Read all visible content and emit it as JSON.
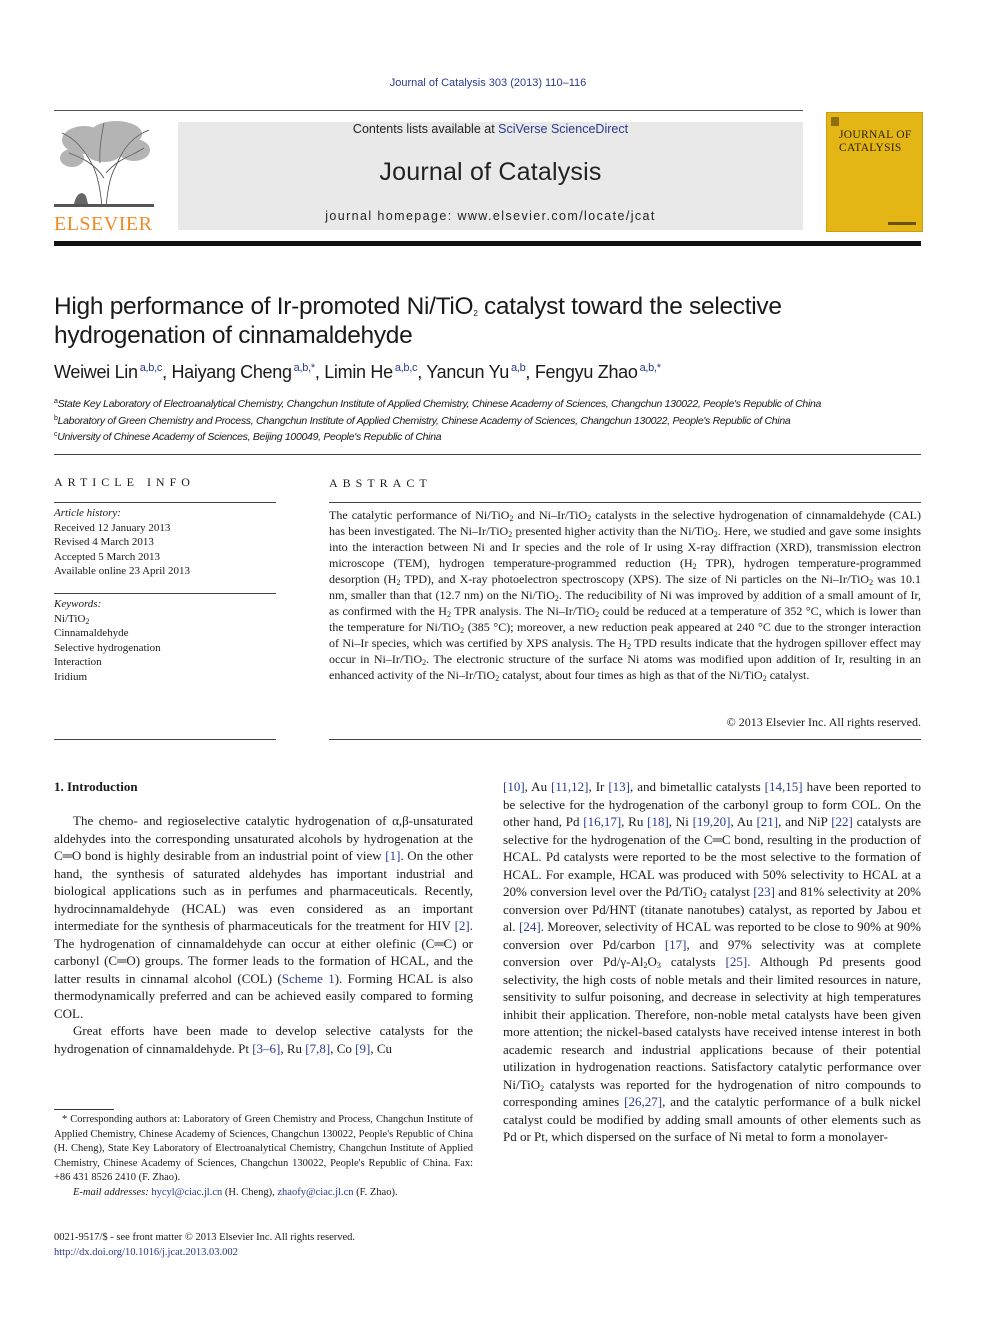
{
  "header": {
    "journal_ref": "Journal of Catalysis 303 (2013) 110–116",
    "contents_prefix": "Contents lists available at ",
    "contents_link": "SciVerse ScienceDirect",
    "journal_name": "Journal of Catalysis",
    "homepage": "journal homepage: www.elsevier.com/locate/jcat",
    "publisher_logo_text": "ELSEVIER",
    "cover_title_line1": "JOURNAL OF",
    "cover_title_line2": "CATALYSIS",
    "colors": {
      "publisher_orange": "#f08a24",
      "cover_yellow": "#e3b616",
      "banner_gray": "#e9e9e9",
      "link_blue": "#2a3a8c"
    }
  },
  "article": {
    "title_part1": "High performance of Ir-promoted Ni/TiO",
    "title_sub": "2",
    "title_part2": " catalyst toward the selective hydrogenation of cinnamaldehyde",
    "authors": [
      {
        "name": "Weiwei Lin",
        "sup": "a,b,c",
        "sep": ", "
      },
      {
        "name": "Haiyang Cheng",
        "sup": "a,b,*",
        "sep": ", "
      },
      {
        "name": "Limin He",
        "sup": "a,b,c",
        "sep": ", "
      },
      {
        "name": "Yancun Yu",
        "sup": "a,b",
        "sep": ", "
      },
      {
        "name": "Fengyu Zhao",
        "sup": "a,b,*",
        "sep": ""
      }
    ],
    "affiliations": [
      {
        "mark": "a",
        "text": "State Key Laboratory of Electroanalytical Chemistry, Changchun Institute of Applied Chemistry, Chinese Academy of Sciences, Changchun 130022, People's Republic of China"
      },
      {
        "mark": "b",
        "text": "Laboratory of Green Chemistry and Process, Changchun Institute of Applied Chemistry, Chinese Academy of Sciences, Changchun 130022, People's Republic of China"
      },
      {
        "mark": "c",
        "text": "University of Chinese Academy of Sciences, Beijing 100049, People's Republic of China"
      }
    ]
  },
  "article_info": {
    "heading": "ARTICLE INFO",
    "history_label": "Article history:",
    "history": [
      "Received 12 January 2013",
      "Revised 4 March 2013",
      "Accepted 5 March 2013",
      "Available online 23 April 2013"
    ],
    "keywords_label": "Keywords:",
    "keyword_first_main": "Ni/TiO",
    "keyword_first_sub": "2",
    "keywords_rest": [
      "Cinnamaldehyde",
      "Selective hydrogenation",
      "Interaction",
      "Iridium"
    ]
  },
  "abstract": {
    "heading": "ABSTRACT",
    "segments": [
      "The catalytic performance of Ni/TiO",
      {
        "sub": "2"
      },
      " and Ni–Ir/TiO",
      {
        "sub": "2"
      },
      " catalysts in the selective hydrogenation of cinnamaldehyde (CAL) has been investigated. The Ni–Ir/TiO",
      {
        "sub": "2"
      },
      " presented higher activity than the Ni/TiO",
      {
        "sub": "2"
      },
      ". Here, we studied and gave some insights into the interaction between Ni and Ir species and the role of Ir using X-ray diffraction (XRD), transmission electron microscope (TEM), hydrogen temperature-programmed reduction (H",
      {
        "sub": "2"
      },
      " TPR), hydrogen temperature-programmed desorption (H",
      {
        "sub": "2"
      },
      " TPD), and X-ray photoelectron spectroscopy (XPS). The size of Ni particles on the Ni–Ir/TiO",
      {
        "sub": "2"
      },
      " was 10.1 nm, smaller than that (12.7 nm) on the Ni/TiO",
      {
        "sub": "2"
      },
      ". The reducibility of Ni was improved by addition of a small amount of Ir, as confirmed with the H",
      {
        "sub": "2"
      },
      " TPR analysis. The Ni–Ir/TiO",
      {
        "sub": "2"
      },
      " could be reduced at a temperature of 352 °C, which is lower than the temperature for Ni/TiO",
      {
        "sub": "2"
      },
      " (385 °C); moreover, a new reduction peak appeared at 240 °C due to the stronger interaction of Ni–Ir species, which was certified by XPS analysis. The H",
      {
        "sub": "2"
      },
      " TPD results indicate that the hydrogen spillover effect may occur in Ni–Ir/TiO",
      {
        "sub": "2"
      },
      ". The electronic structure of the surface Ni atoms was modified upon addition of Ir, resulting in an enhanced activity of the Ni–Ir/TiO",
      {
        "sub": "2"
      },
      " catalyst, about four times as high as that of the Ni/TiO",
      {
        "sub": "2"
      },
      " catalyst."
    ],
    "copyright": "© 2013 Elsevier Inc. All rights reserved."
  },
  "body": {
    "intro_heading": "1. Introduction",
    "left_paragraphs": [
      [
        "The chemo- and regioselective catalytic hydrogenation of α,β-unsaturated aldehydes into the corresponding unsaturated alcohols by hydrogenation at the C═O bond is highly desirable from an industrial point of view ",
        {
          "ref": "[1]"
        },
        ". On the other hand, the synthesis of saturated aldehydes has important industrial and biological applications such as in perfumes and pharmaceuticals. Recently, hydrocinnamaldehyde (HCAL) was even considered as an important intermediate for the synthesis of pharmaceuticals for the treatment for HIV ",
        {
          "ref": "[2]"
        },
        ". The hydrogenation of cinnamaldehyde can occur at either olefinic (C═C) or carbonyl (C═O) groups. The former leads to the formation of HCAL, and the latter results in cinnamal alcohol (COL) (",
        {
          "ref": "Scheme 1"
        },
        "). Forming HCAL is also thermodynamically preferred and can be achieved easily compared to forming COL."
      ],
      [
        "Great efforts have been made to develop selective catalysts for the hydrogenation of cinnamaldehyde. Pt ",
        {
          "ref": "[3–6]"
        },
        ", Ru ",
        {
          "ref": "[7,8]"
        },
        ", Co ",
        {
          "ref": "[9]"
        },
        ", Cu"
      ]
    ],
    "right_paragraph": [
      {
        "ref": "[10]"
      },
      ", Au ",
      {
        "ref": "[11,12]"
      },
      ", Ir ",
      {
        "ref": "[13]"
      },
      ", and bimetallic catalysts ",
      {
        "ref": "[14,15]"
      },
      " have been reported to be selective for the hydrogenation of the carbonyl group to form COL. On the other hand, Pd ",
      {
        "ref": "[16,17]"
      },
      ", Ru ",
      {
        "ref": "[18]"
      },
      ", Ni ",
      {
        "ref": "[19,20]"
      },
      ", Au ",
      {
        "ref": "[21]"
      },
      ", and NiP ",
      {
        "ref": "[22]"
      },
      " catalysts are selective for the hydrogenation of the C═C bond, resulting in the production of HCAL. Pd catalysts were reported to be the most selective to the formation of HCAL. For example, HCAL was produced with 50% selectivity to HCAL at a 20% conversion level over the Pd/TiO",
      {
        "sub": "2"
      },
      " catalyst ",
      {
        "ref": "[23]"
      },
      " and 81% selectivity at 20% conversion over Pd/HNT (titanate nanotubes) catalyst, as reported by Jabou et al. ",
      {
        "ref": "[24]"
      },
      ". Moreover, selectivity of HCAL was reported to be close to 90% at 90% conversion over Pd/carbon ",
      {
        "ref": "[17]"
      },
      ", and 97% selectivity was at complete conversion over Pd/γ-Al",
      {
        "sub": "2"
      },
      "O",
      {
        "sub": "3"
      },
      " catalysts ",
      {
        "ref": "[25]"
      },
      ". Although Pd presents good selectivity, the high costs of noble metals and their limited resources in nature, sensitivity to sulfur poisoning, and decrease in selectivity at high temperatures inhibit their application. Therefore, non-noble metal catalysts have been given more attention; the nickel-based catalysts have received intense interest in both academic research and industrial applications because of their potential utilization in hydrogenation reactions. Satisfactory catalytic performance over Ni/TiO",
      {
        "sub": "2"
      },
      " catalysts was reported for the hydrogenation of nitro compounds to corresponding amines ",
      {
        "ref": "[26,27]"
      },
      ", and the catalytic performance of a bulk nickel catalyst could be modified by adding small amounts of other elements such as Pd or Pt, which dispersed on the surface of Ni metal to form a monolayer-"
    ]
  },
  "footnote": {
    "corresponding": "* Corresponding authors at: Laboratory of Green Chemistry and Process, Changchun Institute of Applied Chemistry, Chinese Academy of Sciences, Changchun 130022, People's Republic of China (H. Cheng), State Key Laboratory of Electroanalytical Chemistry, Changchun Institute of Applied Chemistry, Chinese Academy of Sciences, Changchun 130022, People's Republic of China. Fax: +86 431 8526 2410 (F. Zhao).",
    "email_label": "E-mail addresses: ",
    "email1": "hycyl@ciac.jl.cn",
    "email1_owner": " (H. Cheng), ",
    "email2": "zhaofy@ciac.jl.cn",
    "email2_owner": " (F. Zhao).",
    "front_matter": "0021-9517/$ - see front matter © 2013 Elsevier Inc. All rights reserved.",
    "doi": "http://dx.doi.org/10.1016/j.jcat.2013.03.002"
  }
}
